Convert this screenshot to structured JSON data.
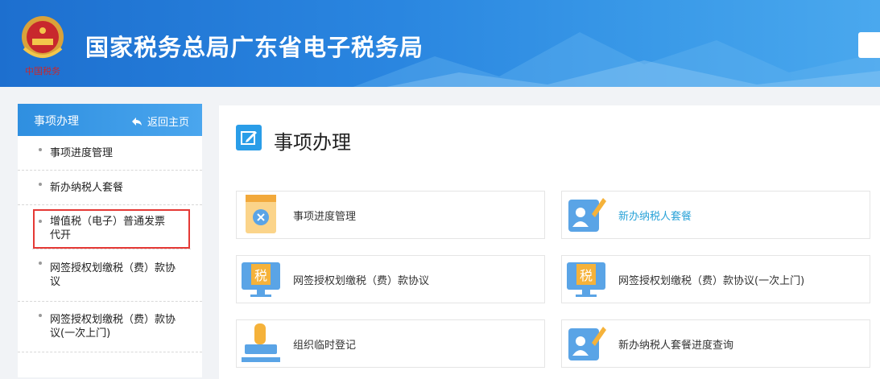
{
  "header": {
    "title": "国家税务总局广东省电子税务局",
    "emblem_text": "中国税务"
  },
  "sidebar": {
    "title": "事项办理",
    "back_label": "返回主页",
    "items": [
      {
        "label": "事项进度管理"
      },
      {
        "label": "新办纳税人套餐"
      },
      {
        "label": "增值税（电子）普通发票代开"
      },
      {
        "label": "网签授权划缴税（费）款协议"
      },
      {
        "label": "网签授权划缴税（费）款协议(一次上门)"
      }
    ]
  },
  "main": {
    "title": "事项办理",
    "cards": [
      {
        "label": "事项进度管理",
        "icon": "document-x-icon"
      },
      {
        "label": "新办纳税人套餐",
        "icon": "user-pen-icon"
      },
      {
        "label": "网签授权划缴税（费）款协议",
        "icon": "tax-monitor-icon"
      },
      {
        "label": "网签授权划缴税（费）款协议(一次上门)",
        "icon": "tax-monitor-icon"
      },
      {
        "label": "组织临时登记",
        "icon": "stamp-icon"
      },
      {
        "label": "新办纳税人套餐进度查询",
        "icon": "user-pen-icon"
      }
    ]
  },
  "colors": {
    "accent": "#2a9de8",
    "link": "#2aa3d8",
    "highlight": "#e53935"
  }
}
